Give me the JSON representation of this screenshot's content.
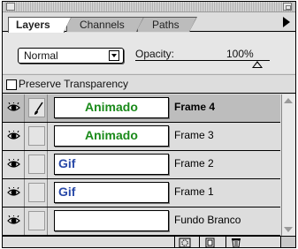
{
  "tabs": [
    {
      "label": "Layers",
      "active": true
    },
    {
      "label": "Channels",
      "active": false
    },
    {
      "label": "Paths",
      "active": false
    }
  ],
  "blend_mode": {
    "value": "Normal"
  },
  "opacity": {
    "label": "Opacity:",
    "value": "100%",
    "level": 1.0
  },
  "preserve_transparency": {
    "label": "Preserve Transparency",
    "checked": false
  },
  "layers": [
    {
      "name": "Frame 4",
      "thumb_text": "Animado",
      "thumb_color": "#1a8a1a",
      "visible": true,
      "brush": true,
      "selected": true
    },
    {
      "name": "Frame 3",
      "thumb_text": "Animado",
      "thumb_color": "#1a8a1a",
      "visible": true,
      "brush": false,
      "selected": false
    },
    {
      "name": "Frame 2",
      "thumb_text": "Gif",
      "thumb_color": "#2a4aa8",
      "visible": true,
      "brush": false,
      "selected": false
    },
    {
      "name": "Frame 1",
      "thumb_text": "Gif",
      "thumb_color": "#2a4aa8",
      "visible": true,
      "brush": false,
      "selected": false
    },
    {
      "name": "Fundo Branco",
      "thumb_text": "",
      "thumb_color": "#000000",
      "visible": true,
      "brush": false,
      "selected": false
    }
  ],
  "colors": {
    "panel_bg": "#dddddd",
    "selected_row": "#bdbdbd"
  },
  "icons": {
    "visibility": "eye-icon",
    "paint": "brush-icon",
    "mask": "layer-mask-icon",
    "new_layer": "new-layer-icon",
    "delete": "trash-icon"
  }
}
